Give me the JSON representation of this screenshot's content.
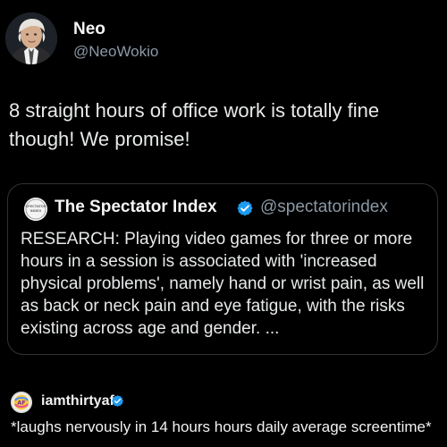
{
  "post": {
    "author_name": "Neo",
    "author_handle": "@NeoWokio",
    "text": "8 straight hours of office work is totally fine though! We promise!",
    "avatar_icon": "profile-photo",
    "quote": {
      "author_name": "The Spectator Index",
      "author_handle": "@spectatorindex",
      "avatar_icon": "spectator-index-logo",
      "verified_icon": "verified-badge-icon",
      "text": "RESEARCH: Playing video games for three or more hours in a session is associated with 'increased physical problems', namely hand or wrist pain, as well as back or neck pain and eye fatigue, with the risks existing across age and gender. ..."
    }
  },
  "caption": {
    "username": "iamthirtyaf",
    "avatar_icon": "iamthirtyaf-avatar",
    "verified_icon": "verified-badge-icon",
    "text": "*laughs nervously in 14 hours hours daily average screentime*"
  },
  "colors": {
    "background": "#000000",
    "primary_text": "#e7e9ea",
    "secondary_text": "#8b98a5",
    "border": "#2f3336",
    "verified": "#1d9bf0"
  }
}
